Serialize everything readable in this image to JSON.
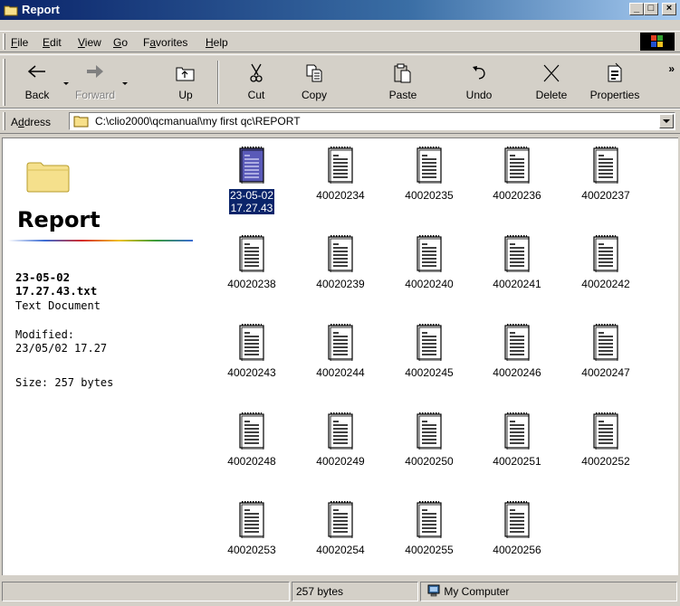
{
  "window": {
    "title": "Report"
  },
  "menu": [
    {
      "label": "File",
      "key": "F",
      "rest": "ile"
    },
    {
      "label": "Edit",
      "key": "E",
      "rest": "dit"
    },
    {
      "label": "View",
      "key": "V",
      "rest": "iew"
    },
    {
      "label": "Go",
      "key": "G",
      "rest": "o"
    },
    {
      "label": "Favorites",
      "key": "a",
      "pre": "F",
      "rest": "vorites"
    },
    {
      "label": "Help",
      "key": "H",
      "rest": "elp"
    }
  ],
  "toolbar": {
    "back": "Back",
    "forward": "Forward",
    "up": "Up",
    "cut": "Cut",
    "copy": "Copy",
    "paste": "Paste",
    "undo": "Undo",
    "delete": "Delete",
    "properties": "Properties",
    "more": "»"
  },
  "address": {
    "label_key": "d",
    "label_pre": "A",
    "label_rest": "dress",
    "value": "C:\\clio2000\\qcmanual\\my first qc\\REPORT"
  },
  "left_pane": {
    "folder_name": "Report",
    "selected_name_line1": "23-05-02",
    "selected_name_line2": "17.27.43.txt",
    "selected_type": "Text Document",
    "modified_label": "Modified:",
    "modified_value": "23/05/02 17.27",
    "size": "Size: 257 bytes"
  },
  "files": [
    {
      "line1": "23-05-02",
      "line2": "17.27.43",
      "selected": true
    },
    {
      "line1": "40020234"
    },
    {
      "line1": "40020235"
    },
    {
      "line1": "40020236"
    },
    {
      "line1": "40020237"
    },
    {
      "line1": "40020238"
    },
    {
      "line1": "40020239"
    },
    {
      "line1": "40020240"
    },
    {
      "line1": "40020241"
    },
    {
      "line1": "40020242"
    },
    {
      "line1": "40020243"
    },
    {
      "line1": "40020244"
    },
    {
      "line1": "40020245"
    },
    {
      "line1": "40020246"
    },
    {
      "line1": "40020247"
    },
    {
      "line1": "40020248"
    },
    {
      "line1": "40020249"
    },
    {
      "line1": "40020250"
    },
    {
      "line1": "40020251"
    },
    {
      "line1": "40020252"
    },
    {
      "line1": "40020253"
    },
    {
      "line1": "40020254"
    },
    {
      "line1": "40020255"
    },
    {
      "line1": "40020256"
    }
  ],
  "status": {
    "size": "257 bytes",
    "zone": "My Computer"
  },
  "colors": {
    "selection": "#0a246a",
    "title_bar": "#0a246a",
    "chrome": "#d4d0c8"
  }
}
